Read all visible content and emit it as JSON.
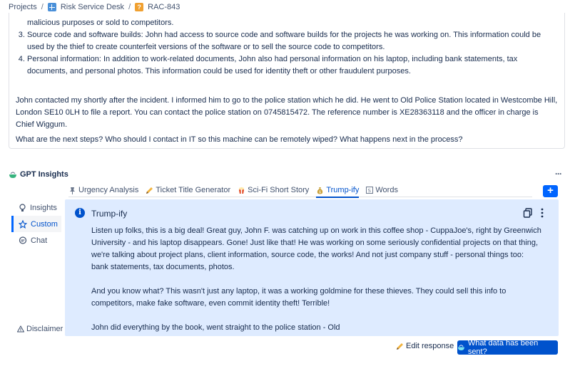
{
  "breadcrumb": {
    "projects": "Projects",
    "separator": "/",
    "project": "Risk Service Desk",
    "issue": "RAC-843"
  },
  "description": {
    "item2_tail": "malicious purposes or sold to competitors.",
    "item3": "Source code and software builds: John had access to source code and software builds for the projects he was working on. This information could be used by the thief to create counterfeit versions of the software or to sell the source code to competitors.",
    "item4": "Personal information: In addition to work-related documents, John also had personal information on his laptop, including bank statements, tax documents, and personal photos. This information could be used for identity theft or other fraudulent purposes.",
    "para1": "John contacted my shortly after the incident. I informed him to go to the police station which he did. He went to Old Police Station located in Westcombe Hill, London SE10 0LH to file a report. You can contact the police station on 0745815472. The reference number is XE28363118 and the officer in charge is Chief Wiggum.",
    "para2": "What are the next steps? Who should I contact in IT so this machine can be remotely wiped? What happens next in the process?"
  },
  "gpt": {
    "title": "GPT Insights",
    "more": "···",
    "tabs": [
      {
        "label": "Urgency Analysis",
        "icon": "pin-icon"
      },
      {
        "label": "Ticket Title Generator",
        "icon": "pencil-icon"
      },
      {
        "label": "Sci-Fi Short Story",
        "icon": "popcorn-icon"
      },
      {
        "label": "Trump-ify",
        "icon": "money-bag-icon"
      },
      {
        "label": "Words",
        "icon": "s-box-icon"
      }
    ],
    "active_tab": "Trump-ify",
    "add": "+",
    "side": [
      {
        "label": "Insights",
        "icon": "bulb-icon"
      },
      {
        "label": "Custom",
        "icon": "star-icon"
      },
      {
        "label": "Chat",
        "icon": "chat-icon"
      }
    ],
    "active_side": "Custom",
    "disclaimer": "Disclaimer",
    "panel": {
      "title": "Trump-ify",
      "paragraphs": [
        "Listen up folks, this is a big deal! Great guy, John F. was catching up on work in this coffee shop - CuppaJoe's, right by Greenwich University - and his laptop disappears. Gone! Just like that! He was working on some seriously confidential projects on that thing, we're talking about project plans, client information, source code, the works! And not just company stuff - personal things too: bank statements, tax documents, photos.",
        "And you know what? This wasn't just any laptop, it was a working goldmine for these thieves. They could sell this info to competitors, make fake software, even commit identity theft! Terrible!",
        "John did everything by the book, went straight to the police station - Old"
      ]
    },
    "edit_label": "Edit response",
    "data_label": "What data has been sent?"
  },
  "colors": {
    "accent": "#0052cc",
    "panel_bg": "#deebff"
  }
}
